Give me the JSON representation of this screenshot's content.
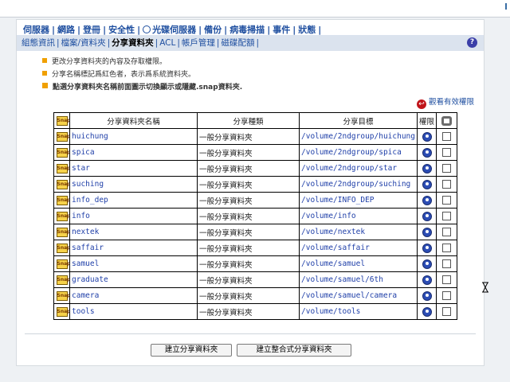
{
  "nav_primary": [
    {
      "label": "伺服器"
    },
    {
      "label": "網路"
    },
    {
      "label": "登冊"
    },
    {
      "label": "安全性"
    },
    {
      "label": "光碟伺服器",
      "icon": "eye-icon"
    },
    {
      "label": "備份"
    },
    {
      "label": "病毒掃描"
    },
    {
      "label": "事件"
    },
    {
      "label": "狀態"
    }
  ],
  "nav_secondary": [
    {
      "label": "組態資訊",
      "active": false
    },
    {
      "label": "檔案/資料夾",
      "active": false
    },
    {
      "label": "分享資料夾",
      "active": true
    },
    {
      "label": "ACL",
      "active": false
    },
    {
      "label": "帳戶管理",
      "active": false
    },
    {
      "label": "磁碟配額",
      "active": false
    }
  ],
  "help_label": "?",
  "notes": [
    "更改分享資料夾的內容及存取權限。",
    "分享名稱標記爲紅色者，表示爲系統資料夾。",
    "點選分享資料夾名稱前面圖示切換顯示或隱藏.snap資料夾."
  ],
  "active_permissions_label": "觀看有效權限",
  "table": {
    "headers": {
      "snap": "Snap",
      "name": "分享資料夾名稱",
      "type": "分享種類",
      "target": "分享目標",
      "perm": "權限"
    },
    "rows": [
      {
        "name": "huichung",
        "type": "一般分享資料夾",
        "target": "/volume/2ndgroup/huichung"
      },
      {
        "name": "spica",
        "type": "一般分享資料夾",
        "target": "/volume/2ndgroup/spica"
      },
      {
        "name": "star",
        "type": "一般分享資料夾",
        "target": "/volume/2ndgroup/star"
      },
      {
        "name": "suching",
        "type": "一般分享資料夾",
        "target": "/volume/2ndgroup/suching"
      },
      {
        "name": "info_dep",
        "type": "一般分享資料夾",
        "target": "/volume/INFO_DEP"
      },
      {
        "name": "info",
        "type": "一般分享資料夾",
        "target": "/volume/info"
      },
      {
        "name": "nextek",
        "type": "一般分享資料夾",
        "target": "/volume/nextek"
      },
      {
        "name": "saffair",
        "type": "一般分享資料夾",
        "target": "/volume/saffair"
      },
      {
        "name": "samuel",
        "type": "一般分享資料夾",
        "target": "/volume/samuel"
      },
      {
        "name": "graduate",
        "type": "一般分享資料夾",
        "target": "/volume/samuel/6th"
      },
      {
        "name": "camera",
        "type": "一般分享資料夾",
        "target": "/volume/samuel/camera"
      },
      {
        "name": "tools",
        "type": "一般分享資料夾",
        "target": "/volume/tools"
      }
    ]
  },
  "buttons": {
    "create": "建立分享資料夾",
    "create_merged": "建立整合式分享資料夾"
  },
  "colors": {
    "link": "#1f4fa0",
    "bullet": "#f0a000",
    "subnav_bg": "#dbe3ee",
    "target_text": "#1f3fa8"
  }
}
